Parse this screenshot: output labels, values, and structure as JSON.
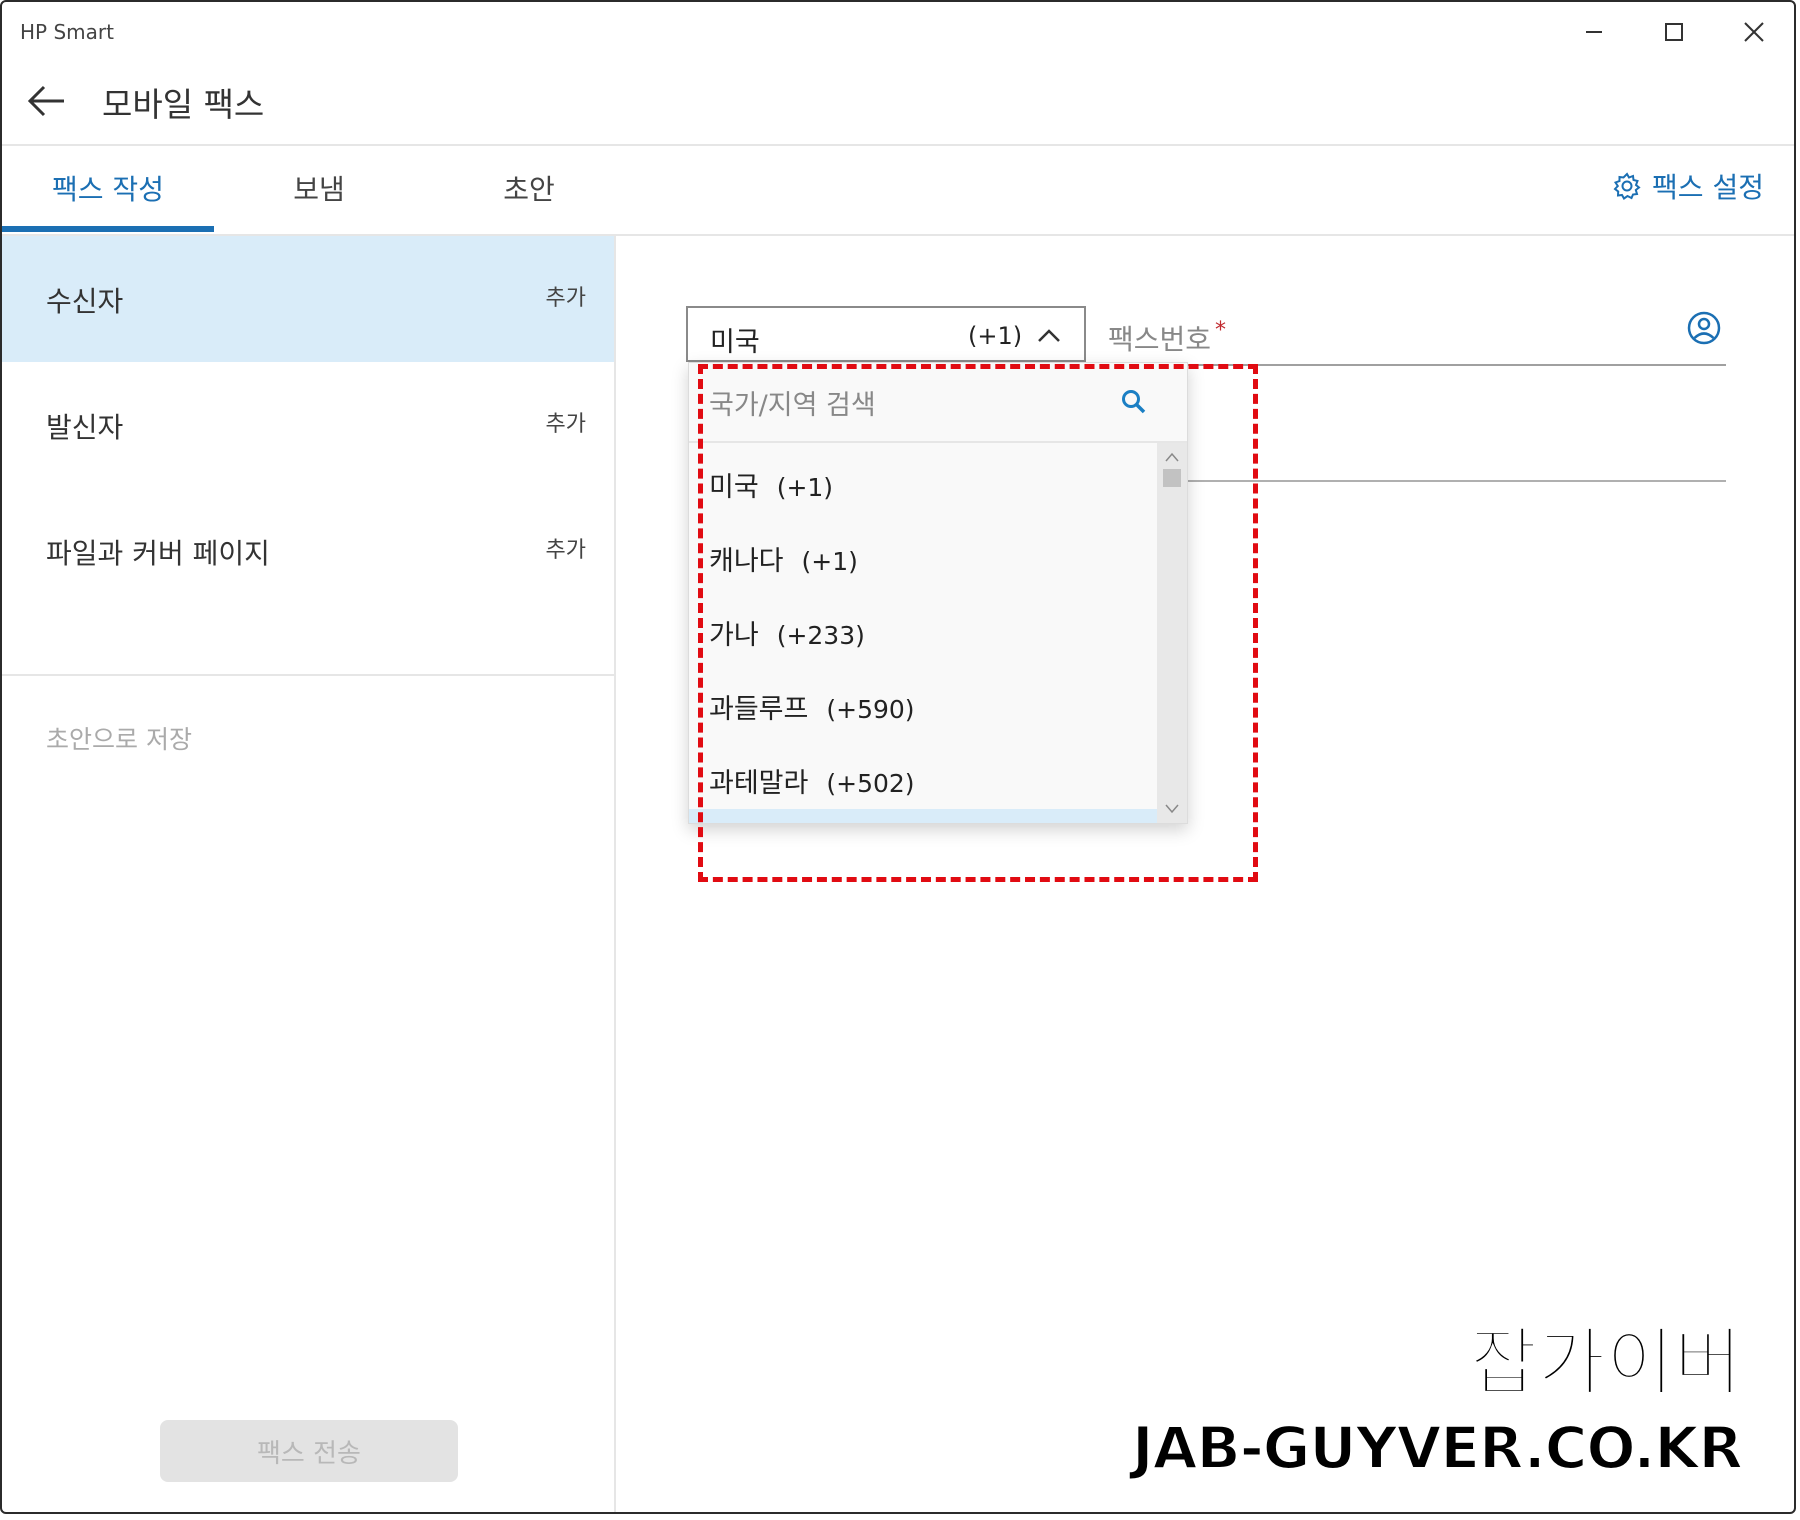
{
  "app": {
    "title": "HP Smart",
    "page_title": "모바일 팩스"
  },
  "window_controls": [
    "minimize-icon",
    "maximize-icon",
    "close-icon"
  ],
  "tabs": [
    {
      "label": "팩스 작성",
      "active": true
    },
    {
      "label": "보냄",
      "active": false
    },
    {
      "label": "초안",
      "active": false
    }
  ],
  "settings": {
    "label": "팩스 설정",
    "icon": "gear-icon"
  },
  "sidebar": {
    "items": [
      {
        "label": "수신자",
        "action": "추가",
        "selected": true
      },
      {
        "label": "발신자",
        "action": "추가",
        "selected": false
      },
      {
        "label": "파일과 커버 페이지",
        "action": "추가",
        "selected": false
      }
    ],
    "save_draft": "초안으로 저장",
    "send_button": "팩스 전송"
  },
  "form": {
    "country": {
      "name": "미국",
      "code": "(+1)"
    },
    "fax_number_label": "팩스번호",
    "required_mark": "*"
  },
  "dropdown": {
    "search_placeholder": "국가/지역 검색",
    "items": [
      {
        "name": "미국",
        "code": "(+1)"
      },
      {
        "name": "캐나다",
        "code": "(+1)"
      },
      {
        "name": "가나",
        "code": "(+233)"
      },
      {
        "name": "과들루프",
        "code": "(+590)"
      },
      {
        "name": "과테말라",
        "code": "(+502)"
      }
    ]
  },
  "watermark": {
    "korean": "잡가이버",
    "english": "JAB-GUYVER.CO.KR"
  },
  "colors": {
    "accent": "#1b6fb3",
    "selected_bg": "#d9ecf9",
    "highlight": "#e10b12",
    "required": "#c0282d"
  }
}
